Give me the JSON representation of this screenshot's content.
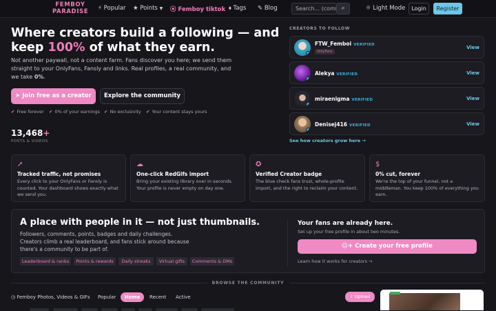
{
  "nav": {
    "logo_line1": "FEMBOY",
    "logo_line2": "PARADISE",
    "popular": "Popular",
    "points": "Points",
    "femboy_tiktok": "Femboy tiktok",
    "tags": "Tags",
    "blog": "Blog",
    "search_placeholder": "Search... (coml",
    "light_mode": "Light Mode",
    "login": "Login",
    "register": "Register"
  },
  "hero": {
    "title_part1": "Where creators build a following — and keep ",
    "title_highlight": "100%",
    "title_part2": " of what they earn.",
    "intro_part1": "Not another paywall, not a content farm. Fans discover you here; we send them straight to your OnlyFans, Fansly and links. Real profiles, a real community, and we take ",
    "intro_bold": "0%",
    "intro_part2": ".",
    "cta_primary": "Join free as a creator",
    "cta_secondary": "Explore the community",
    "perks": [
      "Free forever",
      "0% of your earnings",
      "No exclusivity",
      "Your content stays yours"
    ],
    "stat_value": "13,468",
    "stat_plus": "+",
    "stat_label": "POSTS & VIDEOS"
  },
  "follow": {
    "heading": "CREATORS TO FOLLOW",
    "verified_label": "VERIFIED",
    "view_label": "View",
    "creators": [
      {
        "name": "FTW_Femboi",
        "badge": "OnlyFans"
      },
      {
        "name": "Alekya"
      },
      {
        "name": "miraenigma"
      },
      {
        "name": "Denisej416"
      }
    ],
    "grow_link": "See how creators grow here →"
  },
  "features": [
    {
      "title": "Tracked traffic, not promises",
      "desc": "Every click to your OnlyFans or Fansly is counted. Your dashboard shows exactly what we send you."
    },
    {
      "title": "One-click RedGifs import",
      "desc": "Bring your existing library over in seconds. Your profile is never empty on day one."
    },
    {
      "title": "Verified Creator badge",
      "desc": "The blue check fans trust, whole-profile import, and the right to reclaim your content."
    },
    {
      "title": "0% cut, forever",
      "desc": "We're the top of your funnel, not a middleman. You keep 100% of everything you earn."
    }
  ],
  "community": {
    "title": "A place with people in it — not just thumbnails.",
    "desc": "Followers, comments, points, badges and daily challenges. Creators climb a real leaderboard, and fans stick around because there's a community to be part of.",
    "tags": [
      "Leaderboard & ranks",
      "Points & rewards",
      "Daily streaks",
      "Virtual gifts",
      "Comments & DMs"
    ],
    "fans_title": "Your fans are already here.",
    "fans_sub": "Set up your free profile in about two minutes.",
    "fans_cta": "Create your free profile",
    "learn": "Learn how it works for creators →"
  },
  "browse": {
    "divider": "BROWSE THE COMMUNITY",
    "section": "Femboy Photos, Videos & GIFs",
    "tabs": [
      "Popular",
      "Home",
      "Recent",
      "Active"
    ],
    "upload": "Upload"
  },
  "colors": {
    "accent_pink": "#f07ab8",
    "accent_cyan": "#6cc8e8",
    "background": "#16161b"
  }
}
